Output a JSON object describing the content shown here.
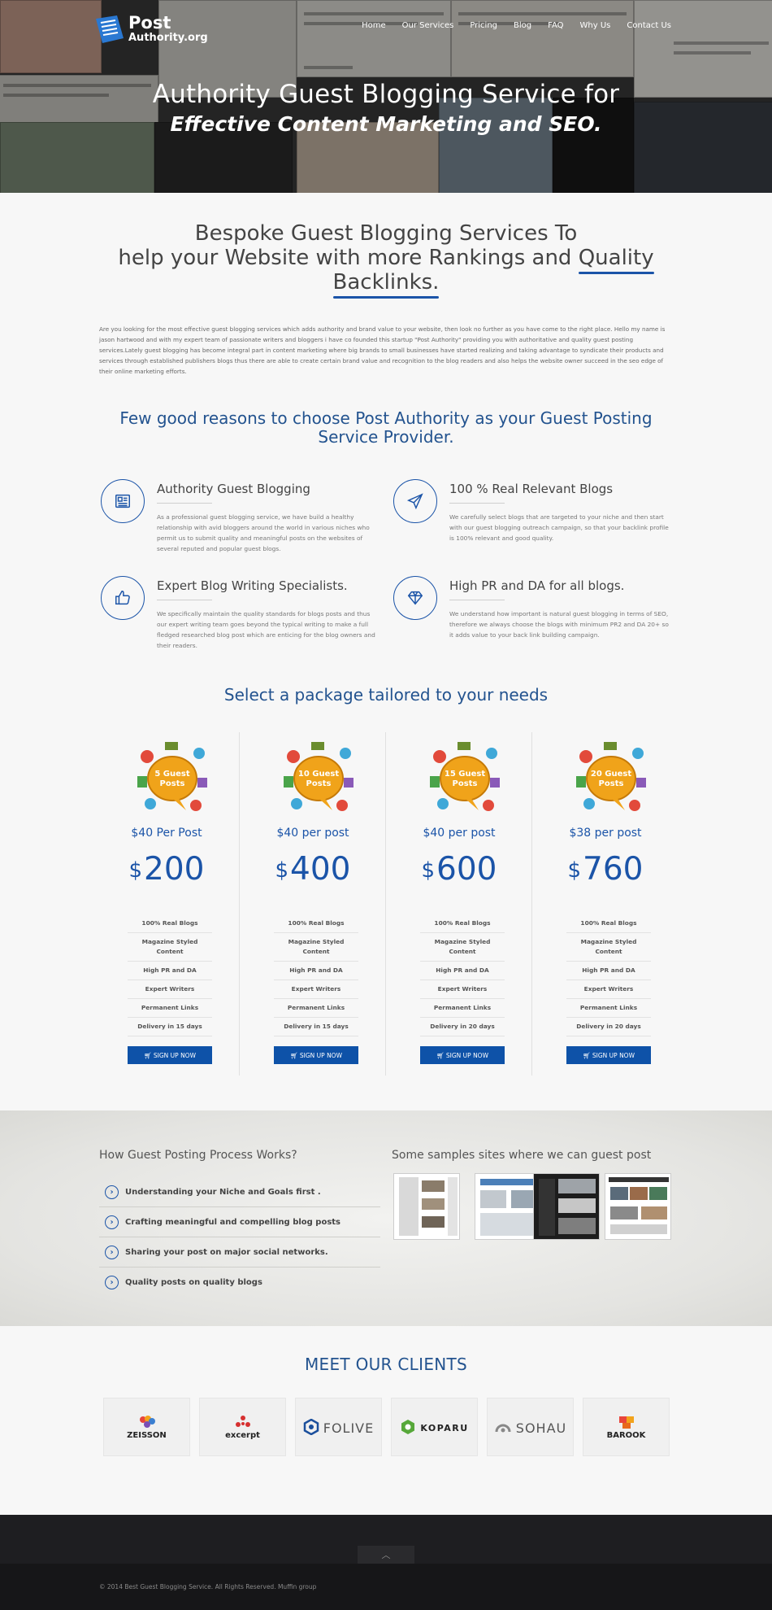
{
  "brand": {
    "name_line1": "Post",
    "name_line2": "Authority.org",
    "color_primary": "#1b54a8"
  },
  "nav": {
    "items": [
      "Home",
      "Our Services",
      "Pricing",
      "Blog",
      "FAQ",
      "Why Us",
      "Contact Us"
    ]
  },
  "hero": {
    "title": "Authority Guest Blogging Service for",
    "subtitle": "Effective Content Marketing and SEO."
  },
  "intro": {
    "heading_line1": "Bespoke Guest Blogging Services To",
    "heading_line2a": "help your Website with more Rankings and ",
    "heading_line2b": "Quality",
    "heading_line3": "Backlinks.",
    "paragraph": "Are you looking for the most effective guest blogging services which adds authority and brand value to your website, then look no further as you have come to the right place. Hello my name is jason hartwood and with my expert team of passionate writers and bloggers i have co founded this startup \"Post Authority\" providing you with authoritative and quality guest posting services.Lately guest blogging has become integral part in content marketing where big brands to small businesses have started realizing and taking advantage to syndicate their products and services through established publishers blogs thus there are able to create certain brand value and recognition to the blog readers and also helps the website owner succeed in the seo edge of their online marketing efforts."
  },
  "reasons": {
    "heading": "Few good reasons to choose Post Authority as your Guest Posting Service Provider.",
    "items": [
      {
        "title": "Authority Guest Blogging",
        "icon": "newspaper-icon",
        "text": "As a professional guest blogging service, we have build a healthy relationship with avid bloggers around the world in various niches who permit us to submit quality and meaningful posts on the websites of several reputed and popular guest blogs."
      },
      {
        "title": "100 % Real Relevant Blogs",
        "icon": "paper-plane-icon",
        "text": "We carefully select blogs that are targeted to your niche and then start with our guest blogging outreach campaign, so that your backlink profile is 100% relevant and good quality."
      },
      {
        "title": "Expert Blog Writing Specialists.",
        "icon": "thumbs-up-icon",
        "text": "We specifically maintain the quality standards for blogs posts and thus our expert writing team goes beyond the typical writing to make a full fledged researched blog post which are enticing for the blog owners and their readers."
      },
      {
        "title": "High PR and DA for all blogs.",
        "icon": "diamond-icon",
        "text": "We understand how important is natural guest blogging in terms of SEO, therefore we always choose the blogs with minimum PR2 and DA 20+ so it adds value to your back link building campaign."
      }
    ]
  },
  "packages": {
    "heading": "Select a package tailored to your needs",
    "currency": "$",
    "button_label": "SIGN UP NOW",
    "items": [
      {
        "badge_line1": "5 Guest",
        "badge_line2": "Posts",
        "per_post": "$40 Per Post",
        "price": "200",
        "features": [
          "100% Real Blogs",
          "Magazine Styled Content",
          "High PR and DA",
          "Expert Writers",
          "Permanent Links",
          "Delivery in 15 days"
        ]
      },
      {
        "badge_line1": "10 Guest",
        "badge_line2": "Posts",
        "per_post": "$40 per post",
        "price": "400",
        "features": [
          "100% Real Blogs",
          "Magazine Styled Content",
          "High PR and DA",
          "Expert Writers",
          "Permanent Links",
          "Delivery in 15 days"
        ]
      },
      {
        "badge_line1": "15 Guest",
        "badge_line2": "Posts",
        "per_post": "$40 per post",
        "price": "600",
        "features": [
          "100% Real Blogs",
          "Magazine Styled Content",
          "High PR and DA",
          "Expert Writers",
          "Permanent Links",
          "Delivery in 20 days"
        ]
      },
      {
        "badge_line1": "20 Guest",
        "badge_line2": "Posts",
        "per_post": "$38 per post",
        "price": "760",
        "features": [
          "100% Real Blogs",
          "Magazine Styled Content",
          "High PR and DA",
          "Expert Writers",
          "Permanent Links",
          "Delivery in 20 days"
        ]
      }
    ]
  },
  "process": {
    "heading": "How Guest Posting Process Works?",
    "items": [
      "Understanding your Niche and Goals first .",
      "Crafting meaningful and compelling blog posts",
      "Sharing your post on major social networks.",
      "Quality posts on quality blogs"
    ]
  },
  "samples": {
    "heading": "Some samples sites where we can guest post"
  },
  "clients": {
    "heading": "MEET OUR CLIENTS",
    "items": [
      "ZEISSON",
      "excerpt",
      "FOLIVE",
      "KOPARU",
      "SOHAU",
      "BAROOK"
    ]
  },
  "footer": {
    "copyright": "© 2014 Best Guest Blogging Service. All Rights Reserved. Muffin group",
    "back_to_top": "︿"
  }
}
